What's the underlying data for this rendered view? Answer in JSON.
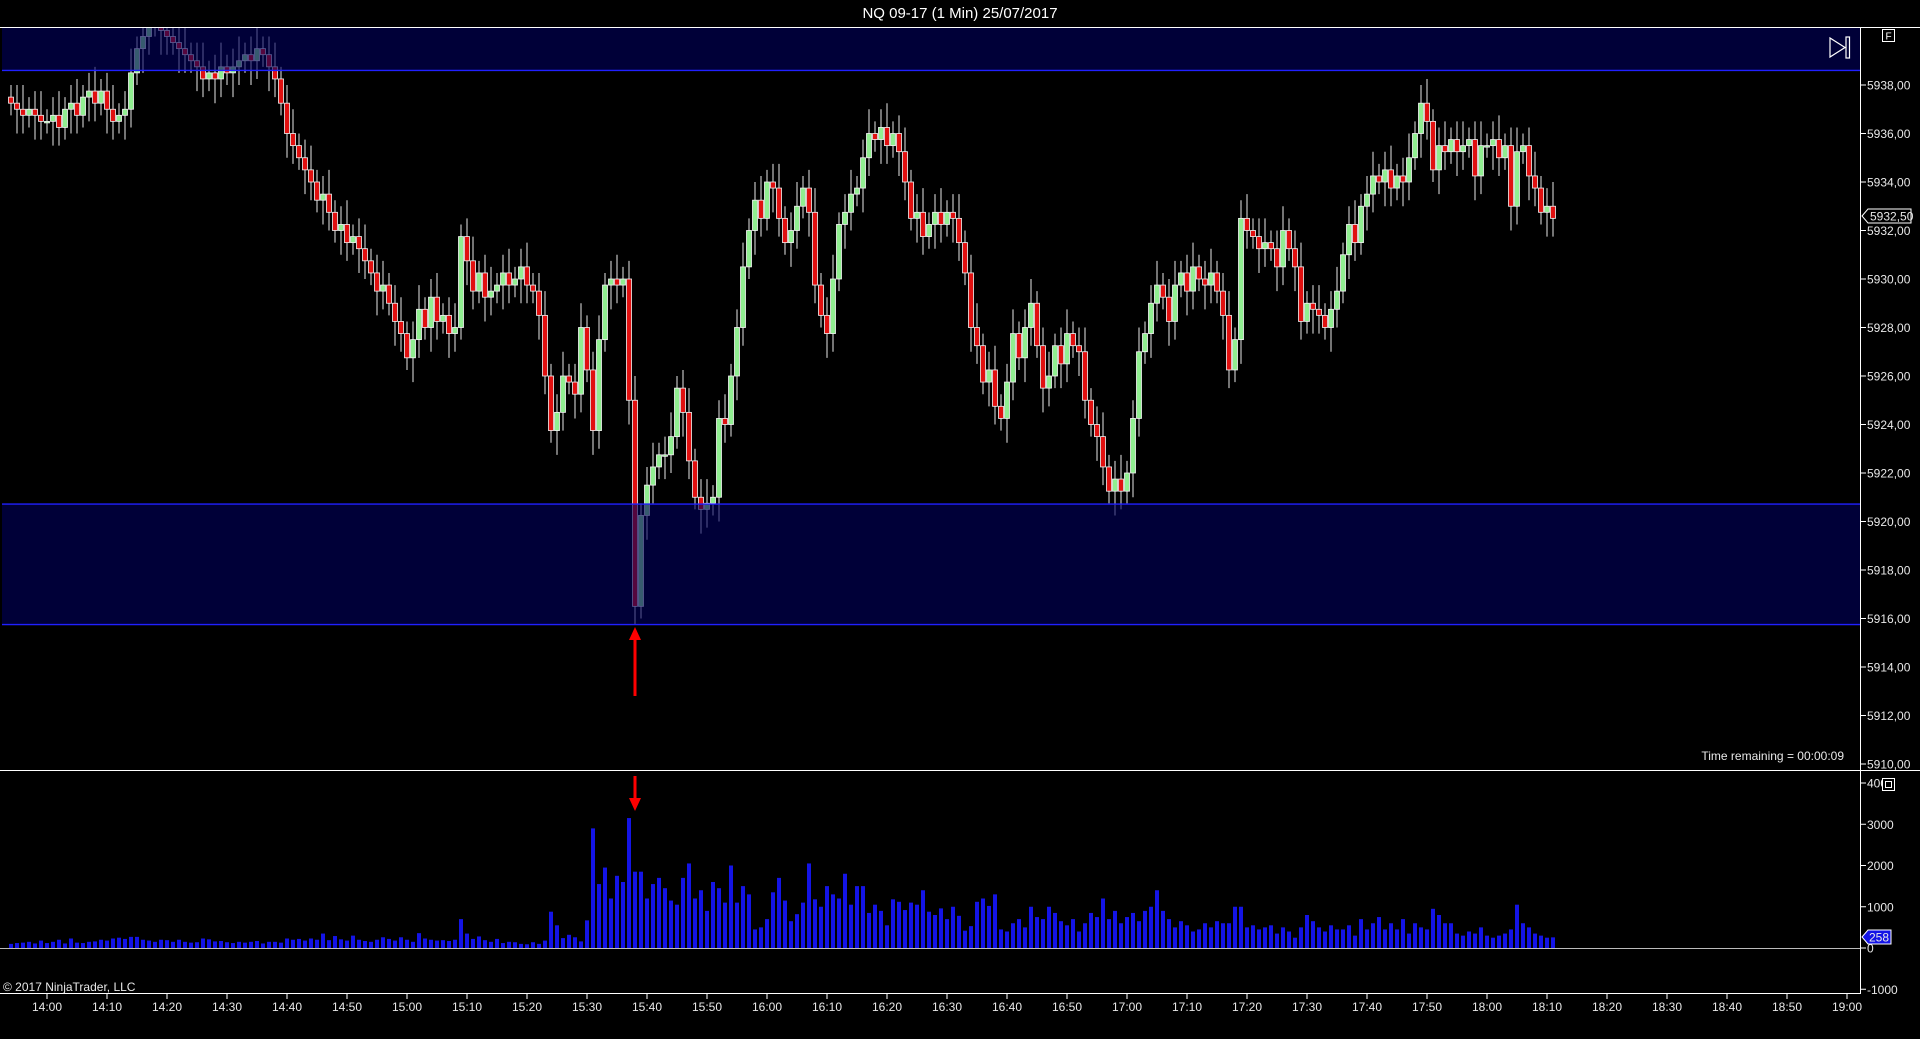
{
  "title": "NQ 09-17 (1 Min)  25/07/2017",
  "copyright": "© 2017 NinjaTrader, LLC",
  "time_remaining": "Time remaining = 00:00:09",
  "icons": {
    "scroll_end": "scroll-to-end-icon",
    "price_panel_f": "f-box-icon",
    "volume_panel": "panel-box-icon"
  },
  "colors": {
    "up": "#90ee90",
    "down": "#e01010",
    "volume": "#1414e6",
    "zone": "#00005a",
    "zone_line": "#2020ff",
    "arrow": "#ff0000"
  },
  "chart_data": [
    {
      "type": "candlestick",
      "start_time": "13:54",
      "interval": "1 Min",
      "close": [
        5937.25,
        5937.0,
        5936.75,
        5937.0,
        5936.75,
        5936.5,
        5936.5,
        5936.75,
        5936.25,
        5937.0,
        5937.25,
        5936.75,
        5937.5,
        5937.75,
        5937.25,
        5937.75,
        5937.0,
        5936.5,
        5936.75,
        5937.0,
        5938.5,
        5939.5,
        5940.0,
        5940.5,
        5940.75,
        5940.25,
        5940.0,
        5939.75,
        5939.5,
        5939.25,
        5939.0,
        5938.75,
        5938.25,
        5938.5,
        5938.25,
        5938.75,
        5938.5,
        5938.75,
        5939.0,
        5939.25,
        5939.0,
        5939.5,
        5939.25,
        5938.75,
        5938.25,
        5937.25,
        5936.0,
        5935.5,
        5935.0,
        5934.5,
        5934.0,
        5933.25,
        5933.5,
        5932.75,
        5932.0,
        5932.25,
        5931.5,
        5931.75,
        5931.25,
        5930.75,
        5930.25,
        5929.5,
        5929.75,
        5929.0,
        5928.25,
        5927.75,
        5926.75,
        5927.5,
        5928.75,
        5928.0,
        5929.25,
        5928.25,
        5928.5,
        5927.75,
        5928.0,
        5931.75,
        5930.75,
        5929.5,
        5930.25,
        5929.25,
        5929.5,
        5929.75,
        5930.25,
        5929.75,
        5930.0,
        5930.5,
        5929.75,
        5929.5,
        5928.5,
        5926.0,
        5923.75,
        5924.5,
        5926.0,
        5925.75,
        5925.25,
        5928.0,
        5926.25,
        5923.75,
        5927.5,
        5929.75,
        5930.0,
        5929.75,
        5930.0,
        5925.0,
        5916.5,
        5920.25,
        5921.5,
        5922.25,
        5922.75,
        5922.75,
        5923.5,
        5925.5,
        5924.5,
        5922.5,
        5921.0,
        5920.5,
        5920.75,
        5921.0,
        5924.25,
        5924.0,
        5926.0,
        5928.0,
        5930.5,
        5932.0,
        5933.25,
        5932.5,
        5934.0,
        5933.75,
        5932.5,
        5931.5,
        5932.0,
        5933.0,
        5933.75,
        5932.75,
        5929.75,
        5928.5,
        5927.75,
        5930.0,
        5932.25,
        5932.75,
        5933.5,
        5933.75,
        5935.0,
        5936.0,
        5935.75,
        5936.25,
        5935.5,
        5936.0,
        5935.25,
        5934.0,
        5932.5,
        5932.75,
        5931.75,
        5932.25,
        5932.75,
        5932.25,
        5932.75,
        5932.5,
        5931.5,
        5930.25,
        5928.0,
        5927.25,
        5925.75,
        5926.25,
        5924.75,
        5924.25,
        5925.75,
        5927.75,
        5926.75,
        5928.0,
        5929.0,
        5927.25,
        5925.5,
        5926.0,
        5927.25,
        5926.5,
        5927.75,
        5927.25,
        5927.0,
        5925.0,
        5924.0,
        5923.5,
        5922.25,
        5921.25,
        5921.75,
        5921.25,
        5922.0,
        5924.25,
        5927.0,
        5927.75,
        5929.0,
        5929.75,
        5929.25,
        5928.25,
        5929.75,
        5930.25,
        5929.5,
        5930.5,
        5930.0,
        5929.75,
        5930.25,
        5929.5,
        5928.5,
        5926.25,
        5927.5,
        5932.5,
        5932.0,
        5931.75,
        5931.25,
        5931.5,
        5931.25,
        5930.5,
        5932.0,
        5931.25,
        5930.5,
        5928.25,
        5929.0,
        5928.75,
        5928.5,
        5928.0,
        5928.75,
        5929.5,
        5931.0,
        5932.25,
        5931.5,
        5933.0,
        5933.5,
        5934.25,
        5934.0,
        5934.5,
        5933.75,
        5934.25,
        5934.0,
        5935.0,
        5936.0,
        5937.25,
        5936.5,
        5934.5,
        5935.5,
        5935.25,
        5935.75,
        5935.25,
        5935.5,
        5935.75,
        5934.25,
        5935.5,
        5935.5,
        5935.75,
        5935.0,
        5935.5,
        5933.0,
        5935.25,
        5935.5,
        5934.25,
        5933.75,
        5932.75,
        5933.0,
        5932.5
      ],
      "first_open": 5937.5,
      "y_ticks": [
        "5938,00",
        "5936,00",
        "5934,00",
        "5932,00",
        "5930,00",
        "5928,00",
        "5926,00",
        "5924,00",
        "5922,00",
        "5920,00",
        "5918,00",
        "5916,00",
        "5914,00",
        "5912,00",
        "5910,00"
      ],
      "y_tick_values": [
        5938,
        5936,
        5934,
        5932,
        5930,
        5928,
        5926,
        5924,
        5922,
        5920,
        5918,
        5916,
        5914,
        5912,
        5910
      ],
      "last_price_label": "5932,50",
      "last_price": 5932.5,
      "zones": [
        {
          "from": 5938.6,
          "to": 5941
        },
        {
          "from": 5915.75,
          "to": 5920.72
        }
      ],
      "arrow_at": "15:38",
      "grid": false
    },
    {
      "type": "bar",
      "series": "volume",
      "values": [
        100,
        120,
        130,
        150,
        110,
        180,
        120,
        150,
        200,
        110,
        230,
        130,
        120,
        150,
        160,
        200,
        180,
        230,
        250,
        220,
        270,
        270,
        200,
        180,
        150,
        200,
        190,
        150,
        200,
        150,
        130,
        140,
        230,
        210,
        160,
        170,
        140,
        120,
        150,
        130,
        150,
        170,
        110,
        150,
        150,
        130,
        230,
        200,
        220,
        180,
        230,
        200,
        350,
        190,
        290,
        210,
        180,
        300,
        200,
        170,
        150,
        200,
        260,
        220,
        180,
        260,
        200,
        150,
        360,
        230,
        200,
        180,
        190,
        170,
        200,
        700,
        350,
        220,
        280,
        190,
        150,
        220,
        120,
        150,
        140,
        100,
        90,
        140,
        100,
        180,
        880,
        550,
        240,
        320,
        260,
        160,
        670,
        2900,
        1550,
        1950,
        1200,
        1750,
        1600,
        3150,
        1850,
        1850,
        1200,
        1550,
        1700,
        1450,
        1150,
        1050,
        1700,
        2050,
        1200,
        1400,
        900,
        1600,
        1450,
        1100,
        2000,
        1100,
        1500,
        1300,
        450,
        500,
        700,
        1350,
        1700,
        1150,
        650,
        820,
        1100,
        2050,
        1180,
        1000,
        1500,
        1300,
        1200,
        1800,
        1050,
        1500,
        1500,
        850,
        1050,
        900,
        550,
        1180,
        1120,
        920,
        1100,
        1050,
        1400,
        880,
        800,
        960,
        700,
        1000,
        780,
        420,
        530,
        1120,
        1200,
        1020,
        1300,
        450,
        400,
        600,
        700,
        500,
        1000,
        750,
        700,
        1000,
        850,
        650,
        550,
        700,
        400,
        600,
        850,
        750,
        1200,
        700,
        900,
        600,
        750,
        850,
        650,
        900,
        1000,
        1400,
        900,
        700,
        500,
        650,
        550,
        400,
        450,
        600,
        500,
        650,
        600,
        600,
        1000,
        1000,
        500,
        550,
        450,
        500,
        550,
        350,
        500,
        400,
        250,
        500,
        800,
        650,
        500,
        400,
        550,
        450,
        450,
        550,
        300,
        700,
        450,
        600,
        750,
        450,
        600,
        450,
        700,
        350,
        600,
        500,
        450,
        950,
        800,
        600,
        600,
        350,
        300,
        400,
        350,
        500,
        300,
        250,
        300,
        350,
        450,
        1050,
        600,
        500,
        350,
        300,
        250,
        258
      ],
      "y_ticks": [
        "4000",
        "3000",
        "2000",
        "1000",
        "0",
        "-1000"
      ],
      "y_tick_values": [
        4000,
        3000,
        2000,
        1000,
        0,
        -1000
      ],
      "last_volume_label": "258",
      "last_volume": 258
    }
  ],
  "x_ticks": [
    "14:00",
    "14:10",
    "14:20",
    "14:30",
    "14:40",
    "14:50",
    "15:00",
    "15:10",
    "15:20",
    "15:30",
    "15:40",
    "15:50",
    "16:00",
    "16:10",
    "16:20",
    "16:30",
    "16:40",
    "16:50",
    "17:00",
    "17:10",
    "17:20",
    "17:30",
    "17:40",
    "17:50",
    "18:00",
    "18:10",
    "18:20",
    "18:30",
    "18:40",
    "18:50",
    "19:00"
  ]
}
